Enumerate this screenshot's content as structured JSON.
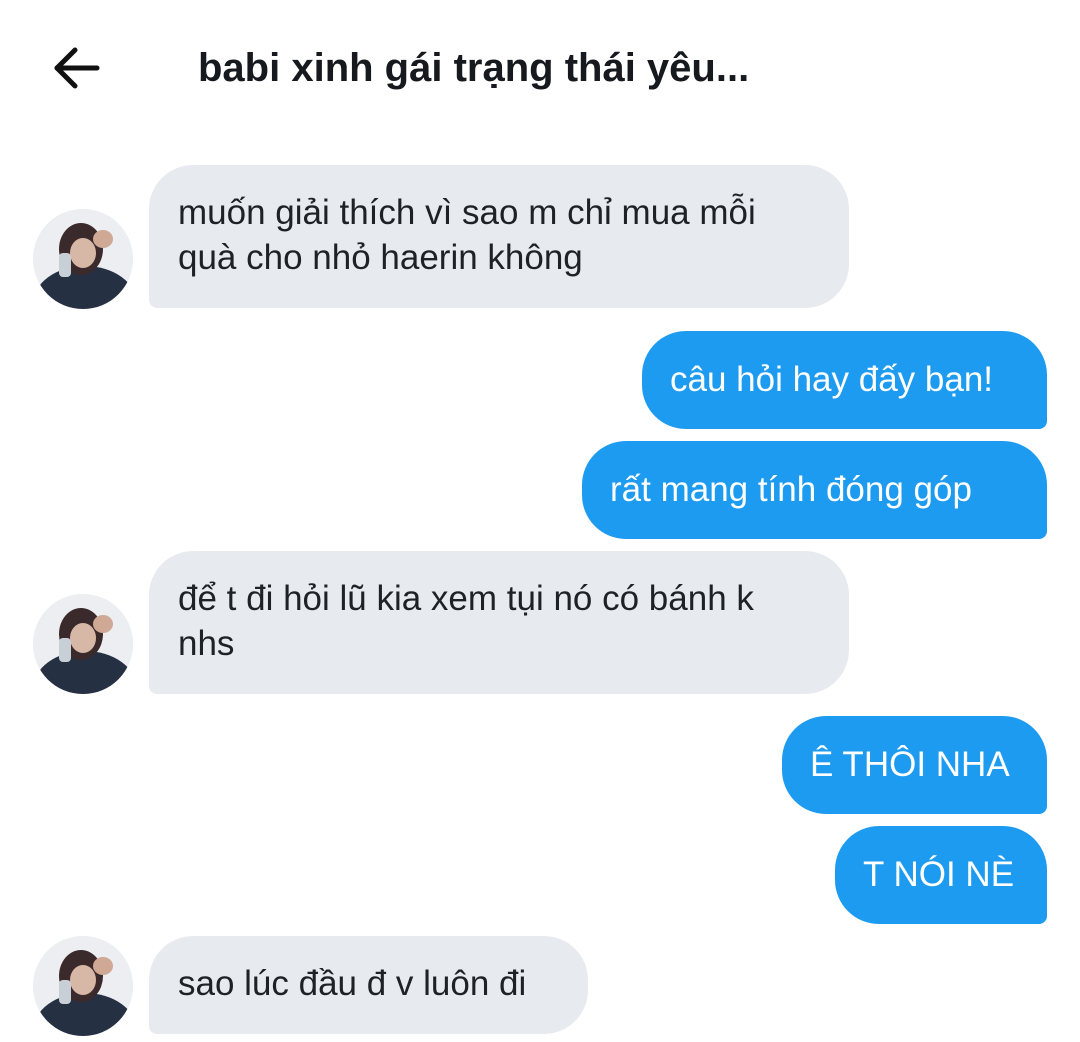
{
  "header": {
    "title": "babi xinh gái trạng thái yêu..."
  },
  "messages": [
    {
      "sender": "them",
      "text": "muốn giải thích vì sao m chỉ mua mỗi quà cho nhỏ haerin không"
    },
    {
      "sender": "me",
      "text": "câu hỏi hay đấy bạn!"
    },
    {
      "sender": "me",
      "text": "rất mang tính đóng góp"
    },
    {
      "sender": "them",
      "text": "để t đi hỏi lũ kia xem tụi nó có bánh k nhs"
    },
    {
      "sender": "me",
      "text": "Ê THÔI NHA"
    },
    {
      "sender": "me",
      "text": "T NÓI NÈ"
    },
    {
      "sender": "them",
      "text": "sao lúc đầu đ v luôn đi"
    }
  ],
  "icons": {
    "back": "arrow-left-icon",
    "avatar": "contact-avatar"
  },
  "colors": {
    "outgoing_bubble": "#1d9bf0",
    "incoming_bubble": "#e7ebef",
    "title_text": "#16191d"
  }
}
